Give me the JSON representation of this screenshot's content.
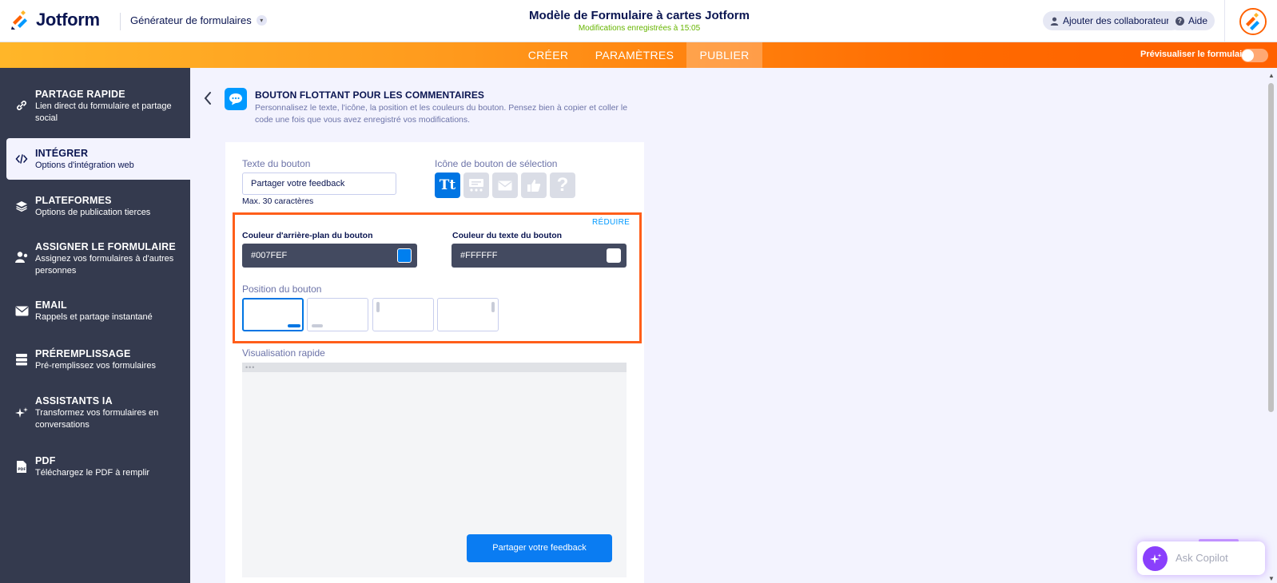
{
  "header": {
    "logo_text": "Jotform",
    "builder_label": "Générateur de formulaires",
    "form_title": "Modèle de Formulaire à cartes Jotform",
    "saved_status": "Modifications enregistrées à 15:05",
    "add_collaborators": "Ajouter des collaborateurs",
    "help": "Aide"
  },
  "nav": {
    "create": "CRÉER",
    "settings": "PARAMÈTRES",
    "publish": "PUBLIER",
    "preview_label": "Prévisualiser le formulaire",
    "preview_enabled": false
  },
  "sidebar": {
    "items": [
      {
        "title": "PARTAGE RAPIDE",
        "desc": "Lien direct du formulaire et partage social",
        "icon": "link-icon",
        "active": false
      },
      {
        "title": "INTÉGRER",
        "desc": "Options d'intégration web",
        "icon": "code-icon",
        "active": true
      },
      {
        "title": "PLATEFORMES",
        "desc": "Options de publication tierces",
        "icon": "layers-icon",
        "active": false
      },
      {
        "title": "ASSIGNER LE FORMULAIRE",
        "desc": "Assignez vos formulaires à d'autres personnes",
        "icon": "assign-user-icon",
        "active": false
      },
      {
        "title": "EMAIL",
        "desc": "Rappels et partage instantané",
        "icon": "envelope-icon",
        "active": false
      },
      {
        "title": "PRÉREMPLISSAGE",
        "desc": "Pré-remplissez vos formulaires",
        "icon": "prefill-icon",
        "active": false
      },
      {
        "title": "ASSISTANTS IA",
        "desc": "Transformez vos formulaires en conversations",
        "icon": "sparkle-icon",
        "active": false
      },
      {
        "title": "PDF",
        "desc": "Téléchargez le PDF à remplir",
        "icon": "pdf-icon",
        "active": false
      }
    ]
  },
  "main": {
    "title": "BOUTON FLOTTANT POUR LES COMMENTAIRES",
    "description": "Personnalisez le texte, l'icône, la position et les couleurs du bouton. Pensez bien à copier et coller le code une fois que vous avez enregistré vos modifications.",
    "button_text_label": "Texte du bouton",
    "button_text_value": "Partager votre feedback",
    "max_chars": "Max. 30 caractères",
    "icon_select_label": "Icône de bouton de sélection",
    "icon_options": [
      "text-tt-icon",
      "chat-feedback-icon",
      "envelope-icon",
      "thumbs-up-icon",
      "question-icon"
    ],
    "icon_text_glyph": "Tt",
    "icon_question_glyph": "?",
    "reduce": "RÉDUIRE",
    "bg_color_label": "Couleur d'arrière-plan du bouton",
    "bg_color_value": "#007FEF",
    "text_color_label": "Couleur du texte du bouton",
    "text_color_value": "#FFFFFF",
    "position_label": "Position du bouton",
    "quick_preview_label": "Visualisation rapide",
    "preview_dots": "•••",
    "feedback_button": "Partager votre feedback"
  },
  "copilot": {
    "label": "Ask Copilot"
  },
  "colors": {
    "accent_orange": "#FF6100",
    "sidebar_bg": "#343A4E",
    "primary_blue": "#0075E3",
    "highlight_box": "#FF5E1A"
  }
}
